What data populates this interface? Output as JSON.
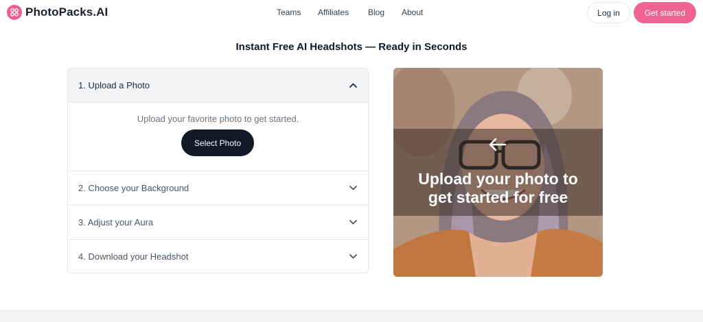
{
  "header": {
    "logo_text": "PhotoPacks.AI",
    "nav": [
      "Teams",
      "Affiliates",
      "Blog",
      "About"
    ],
    "login_label": "Log in",
    "get_started_label": "Get started"
  },
  "main": {
    "title": "Instant Free AI Headshots — Ready in Seconds",
    "steps": [
      {
        "label": "1. Upload a Photo",
        "expanded": true
      },
      {
        "label": "2. Choose your Background",
        "expanded": false
      },
      {
        "label": "3. Adjust your Aura",
        "expanded": false
      },
      {
        "label": "4. Download your Headshot",
        "expanded": false
      }
    ],
    "upload_prompt": "Upload your favorite photo to get started.",
    "select_photo_label": "Select Photo"
  },
  "hero": {
    "line1": "Upload your photo to",
    "line2": "get started for free"
  },
  "colors": {
    "brand_pink": "#ef6393",
    "button_dark": "#111827",
    "active_row_bg": "#f3f4f6"
  },
  "icons": [
    "photopacks-logo-icon",
    "chevron-up-icon",
    "chevron-down-icon",
    "arrow-left-icon"
  ]
}
